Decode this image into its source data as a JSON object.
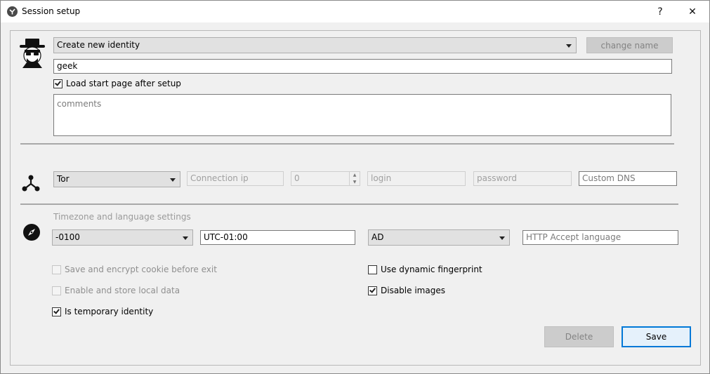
{
  "window": {
    "title": "Session setup",
    "help_label": "?",
    "close_label": "✕"
  },
  "identity": {
    "selector_value": "Create new identity",
    "change_name_label": "change name",
    "name_value": "geek",
    "load_start_page_label": "Load start page after setup",
    "load_start_page_checked": true,
    "comments_placeholder": "comments"
  },
  "connection": {
    "type_value": "Tor",
    "ip_placeholder": "Connection ip",
    "port_value": "0",
    "login_placeholder": "login",
    "password_placeholder": "password",
    "dns_placeholder": "Custom DNS"
  },
  "timezone": {
    "section_label": "Timezone and language settings",
    "offset_value": "-0100",
    "utc_value": "UTC-01:00",
    "country_value": "AD",
    "accept_language_placeholder": "HTTP Accept language"
  },
  "options": {
    "save_cookie_label": "Save and encrypt cookie before exit",
    "local_data_label": "Enable and store local data",
    "temporary_label": "Is temporary identity",
    "dynamic_fp_label": "Use dynamic fingerprint",
    "disable_images_label": "Disable images"
  },
  "actions": {
    "delete_label": "Delete",
    "save_label": "Save"
  },
  "icons": {
    "app": "app-logo-icon",
    "identity": "hat-man-avatar-icon",
    "connection": "network-nodes-icon",
    "timezone": "compass-icon"
  }
}
